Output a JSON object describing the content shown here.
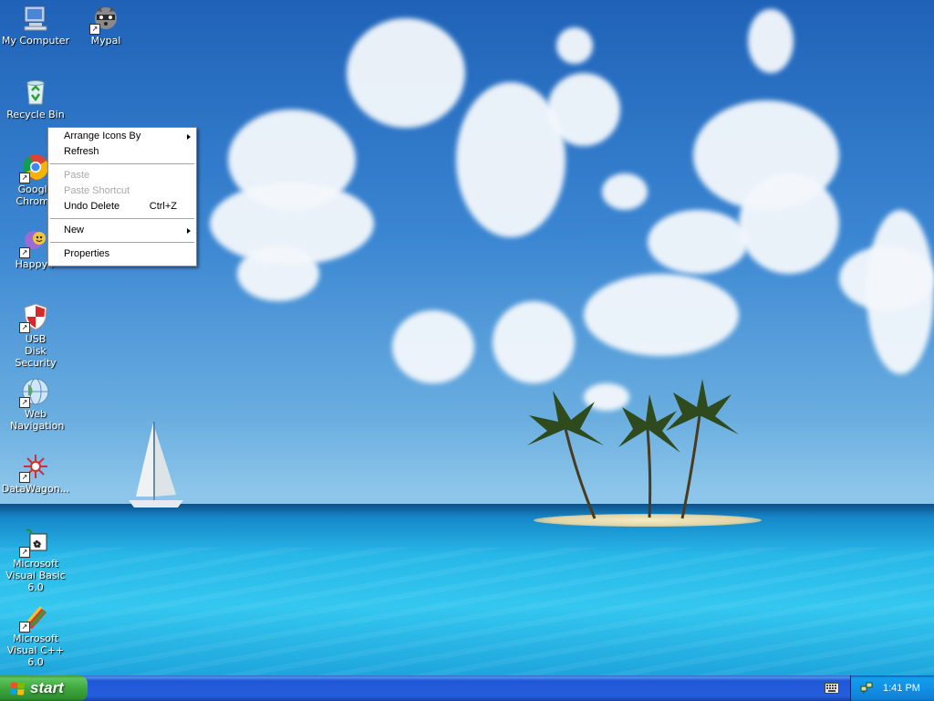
{
  "desktop": {
    "icons": [
      {
        "label": "My Computer",
        "icon": "my-computer-icon"
      },
      {
        "label": "Mypal",
        "icon": "mypal-raccoon-icon"
      },
      {
        "label": "Recycle Bin",
        "icon": "recycle-bin-icon"
      },
      {
        "label": "Google Chrome",
        "icon": "chrome-icon"
      },
      {
        "label": "Happy+",
        "icon": "happy-plus-icon"
      },
      {
        "label": "USB Disk Security",
        "icon": "shield-icon"
      },
      {
        "label": "Web Navigation",
        "icon": "globe-icon"
      },
      {
        "label": "DataWagon...",
        "icon": "datawagon-icon"
      },
      {
        "label": "Microsoft Visual Basic 6.0",
        "icon": "visual-basic-icon"
      },
      {
        "label": "Microsoft Visual C++ 6.0",
        "icon": "visual-cpp-icon"
      }
    ]
  },
  "context_menu": {
    "items": [
      {
        "label": "Arrange Icons By",
        "submenu": true
      },
      {
        "label": "Refresh"
      },
      {
        "label": "Paste",
        "disabled": true
      },
      {
        "label": "Paste Shortcut",
        "disabled": true
      },
      {
        "label": "Undo Delete",
        "shortcut": "Ctrl+Z"
      },
      {
        "label": "New",
        "submenu": true
      },
      {
        "label": "Properties"
      }
    ]
  },
  "taskbar": {
    "start_label": "start",
    "clock": "1:41 PM",
    "tray_icons": [
      "keyboard-icon",
      "network-icon"
    ],
    "colors": {
      "taskbar": "#245edb",
      "start": "#3ea83e",
      "tray": "#1290e8"
    }
  }
}
